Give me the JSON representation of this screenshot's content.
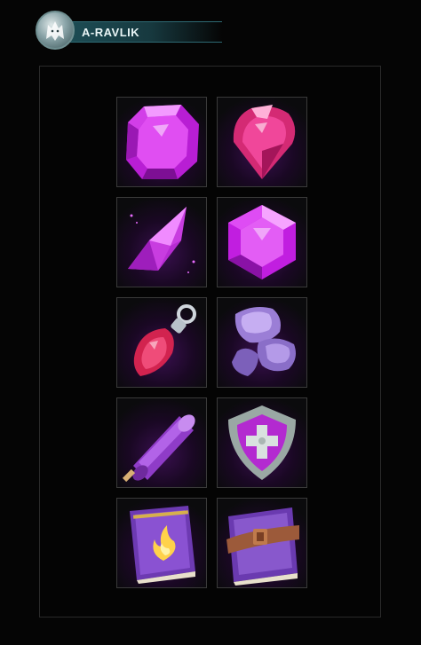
{
  "header": {
    "title": "A-RAVLIK",
    "logo_icon": "wolf-head-icon"
  },
  "icons": [
    {
      "name": "octagon-gem-icon"
    },
    {
      "name": "teardrop-gem-icon"
    },
    {
      "name": "crystal-shard-icon"
    },
    {
      "name": "hexagon-gem-icon"
    },
    {
      "name": "gem-pendant-icon"
    },
    {
      "name": "ore-rocks-icon"
    },
    {
      "name": "scroll-icon"
    },
    {
      "name": "cross-shield-icon"
    },
    {
      "name": "fire-spellbook-icon"
    },
    {
      "name": "strapped-book-icon"
    }
  ],
  "colors": {
    "accent": "#c43ad8",
    "header_bar": "#1d4e56",
    "background": "#050505"
  }
}
